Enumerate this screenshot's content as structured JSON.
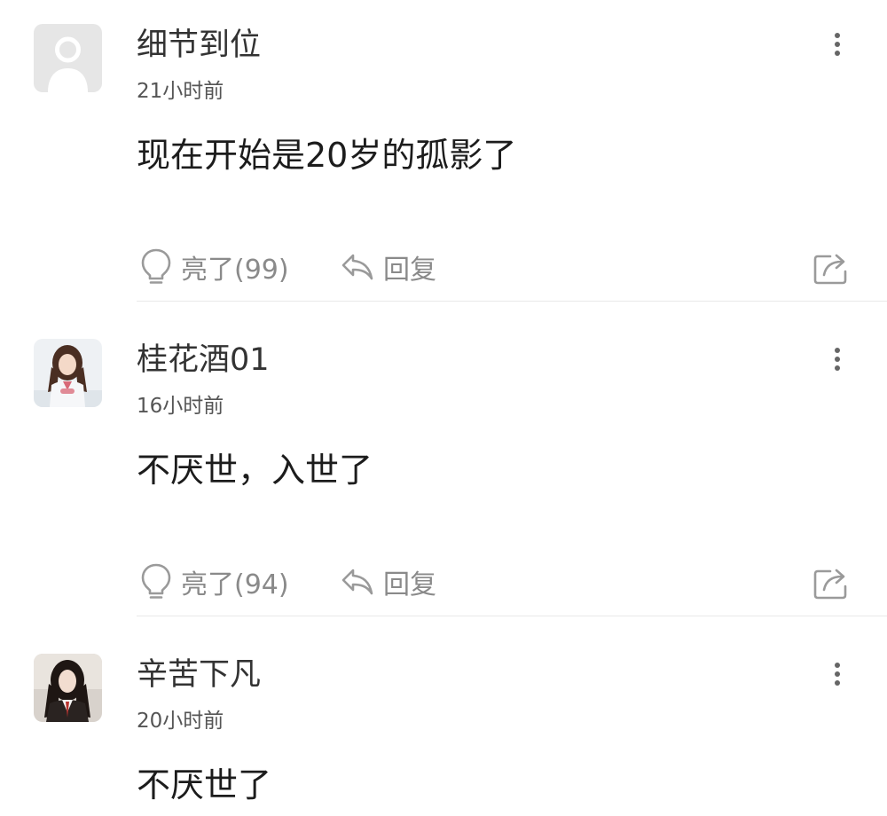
{
  "comments": [
    {
      "username": "细节到位",
      "time": "21小时前",
      "content": "现在开始是20岁的孤影了",
      "like_label": "亮了(99)",
      "reply_label": "回复",
      "avatar": "default-user-avatar"
    },
    {
      "username": "桂花酒01",
      "time": "16小时前",
      "content": "不厌世，入世了",
      "like_label": "亮了(94)",
      "reply_label": "回复",
      "avatar": "girl-photo-avatar"
    },
    {
      "username": "辛苦下凡",
      "time": "20小时前",
      "content": "不厌世了",
      "avatar": "girl-photo-avatar"
    }
  ],
  "icons": {
    "more": "more-vertical-icon",
    "like": "lightbulb-icon",
    "reply": "reply-arrow-icon",
    "share": "share-icon"
  },
  "colors": {
    "text": "#222222",
    "secondary": "#8a8a8a",
    "divider": "#e9e9e9"
  }
}
